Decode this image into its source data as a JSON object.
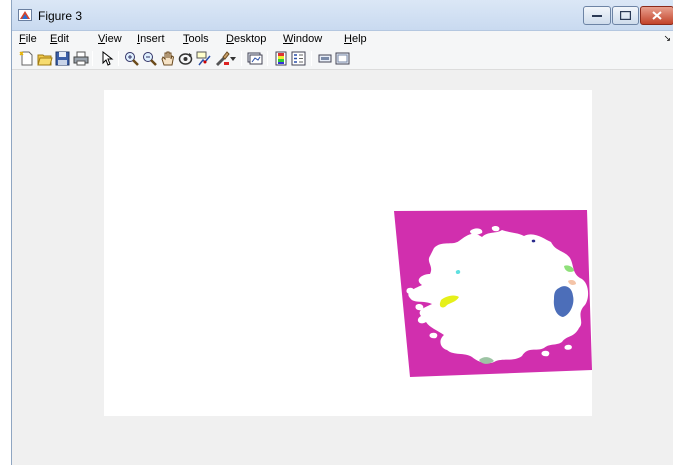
{
  "window": {
    "title": "Figure 3"
  },
  "menu": {
    "items": [
      {
        "mnemonic": "F",
        "rest": "ile"
      },
      {
        "mnemonic": "E",
        "rest": "dit"
      },
      {
        "mnemonic": "V",
        "rest": "iew"
      },
      {
        "mnemonic": "I",
        "rest": "nsert"
      },
      {
        "mnemonic": "T",
        "rest": "ools"
      },
      {
        "mnemonic": "D",
        "rest": "esktop"
      },
      {
        "mnemonic": "W",
        "rest": "indow"
      },
      {
        "mnemonic": "H",
        "rest": "elp"
      }
    ]
  },
  "toolbar": {
    "icons": [
      "new-figure-icon",
      "open-file-icon",
      "save-icon",
      "print-icon",
      "edit-plot-icon",
      "zoom-in-icon",
      "zoom-out-icon",
      "pan-icon",
      "rotate-3d-icon",
      "data-cursor-icon",
      "brush-icon",
      "link-plot-icon",
      "insert-colorbar-icon",
      "insert-legend-icon",
      "hide-plot-tools-icon",
      "show-plot-tools-icon"
    ]
  },
  "colors": {
    "region_magenta": "#d12fae",
    "foreground_white": "#ffffff",
    "blob_blue": "#4c6eb9",
    "blob_yellow": "#e6f01a",
    "blob_green": "#8fe07a",
    "blob_peach": "#f4c4a8",
    "blob_cyan": "#5fe0e0",
    "blob_sage": "#9dc4a4",
    "blob_navy": "#2a2a8c"
  }
}
